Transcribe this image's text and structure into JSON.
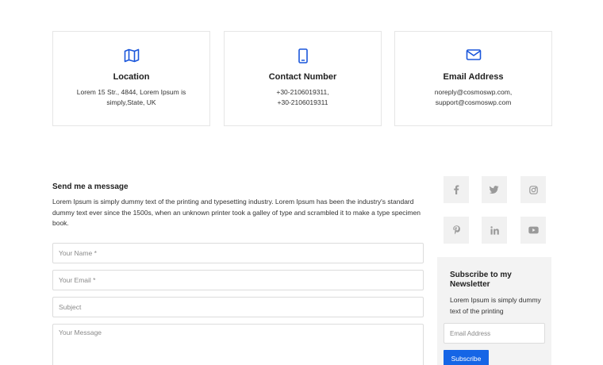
{
  "info_cards": [
    {
      "icon": "map-icon",
      "title": "Location",
      "line1": "Lorem 15 Str., 4844, Lorem Ipsum is",
      "line2": "simply,State, UK"
    },
    {
      "icon": "mobile-phone-icon",
      "title": "Contact Number",
      "line1": "+30-2106019311,",
      "line2": "+30-2106019311"
    },
    {
      "icon": "envelope-icon",
      "title": "Email Address",
      "line1": "noreply@cosmoswp.com,",
      "line2": "support@cosmoswp.com"
    }
  ],
  "contact_form": {
    "title": "Send me a message",
    "description": "Lorem Ipsum is simply dummy text of the printing and typesetting industry. Lorem Ipsum has been the industry's standard dummy text ever since the 1500s, when an unknown printer took a galley of type and scrambled it to make a type specimen book.",
    "name_placeholder": "Your Name *",
    "email_placeholder": "Your Email *",
    "subject_placeholder": "Subject",
    "message_placeholder": "Your Message"
  },
  "social_icons": [
    "facebook-icon",
    "twitter-icon",
    "instagram-icon",
    "pinterest-icon",
    "linkedin-icon",
    "youtube-icon"
  ],
  "newsletter": {
    "title": "Subscribe to my Newsletter",
    "text": "Lorem Ipsum is simply dummy text of the printing",
    "email_placeholder": "Email Address",
    "button_label": "Subscribe"
  },
  "colors": {
    "accent": "#1565e6",
    "icon_blue": "#1a56db",
    "social_icon": "#9a9a9a",
    "panel_bg": "#f3f3f3"
  }
}
